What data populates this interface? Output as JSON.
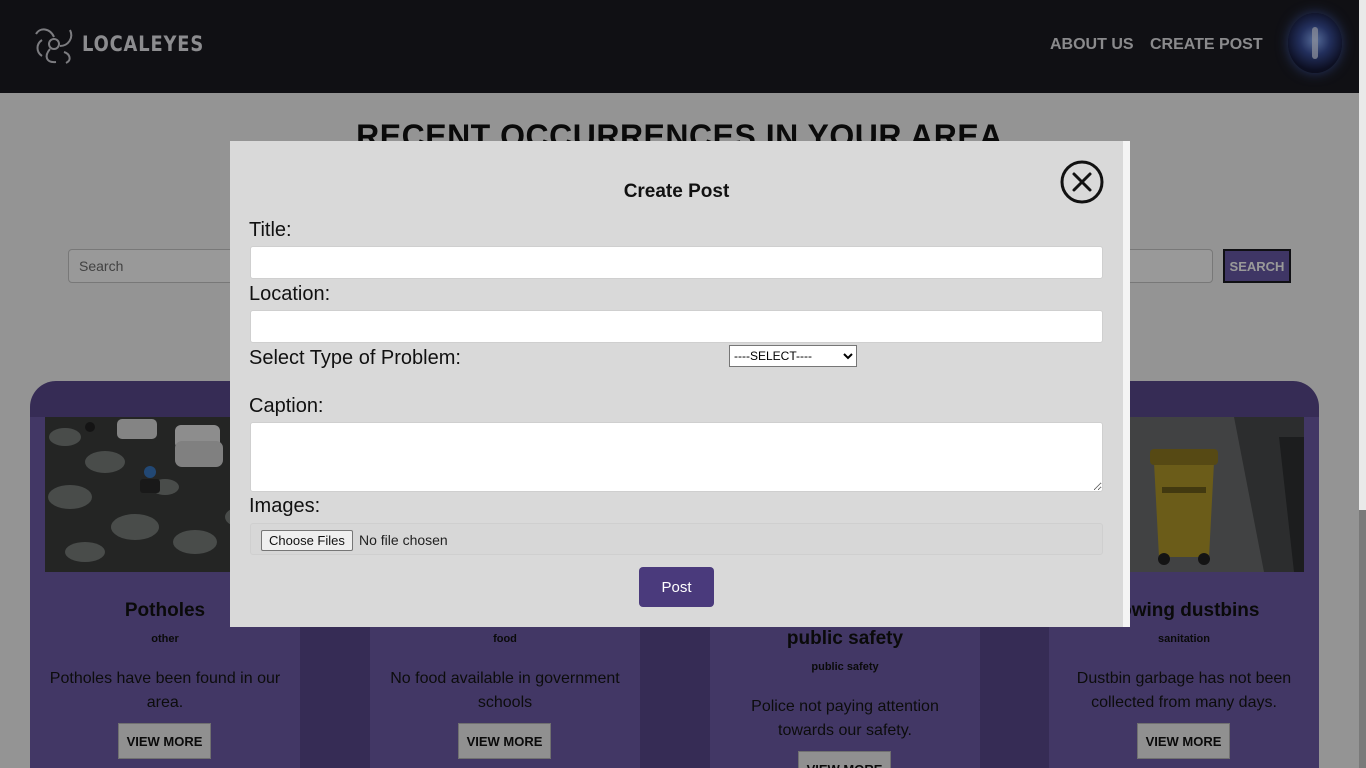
{
  "nav": {
    "brand": "LOCALEYES",
    "links": [
      "ABOUT US",
      "CREATE POST"
    ]
  },
  "main": {
    "heading": "RECENT OCCURRENCES IN YOUR AREA",
    "search_placeholder": "Search",
    "search_button": "SEARCH"
  },
  "cards": [
    {
      "title": "Potholes",
      "category": "other",
      "description": "Potholes have been found in our area.",
      "button": "VIEW MORE"
    },
    {
      "title": "",
      "category": "food",
      "description": "No food available in government schools",
      "button": "VIEW MORE"
    },
    {
      "title": "public safety",
      "category": "public safety",
      "description": "Police not paying attention towards our safety.",
      "button": "VIEW MORE"
    },
    {
      "title": "flowing dustbins",
      "category": "sanitation",
      "description": "Dustbin garbage has not been collected from many days.",
      "button": "VIEW MORE"
    }
  ],
  "modal": {
    "title": "Create Post",
    "labels": {
      "title": "Title:",
      "location": "Location:",
      "problem_type": "Select Type of Problem:",
      "caption": "Caption:",
      "images": "Images:"
    },
    "select_value": "----SELECT----",
    "file_button": "Choose Files",
    "file_status": "No file chosen",
    "post_button": "Post"
  },
  "colors": {
    "navbar": "#1b1b22",
    "accent": "#4a3a7c",
    "card": "#6e5da8"
  }
}
